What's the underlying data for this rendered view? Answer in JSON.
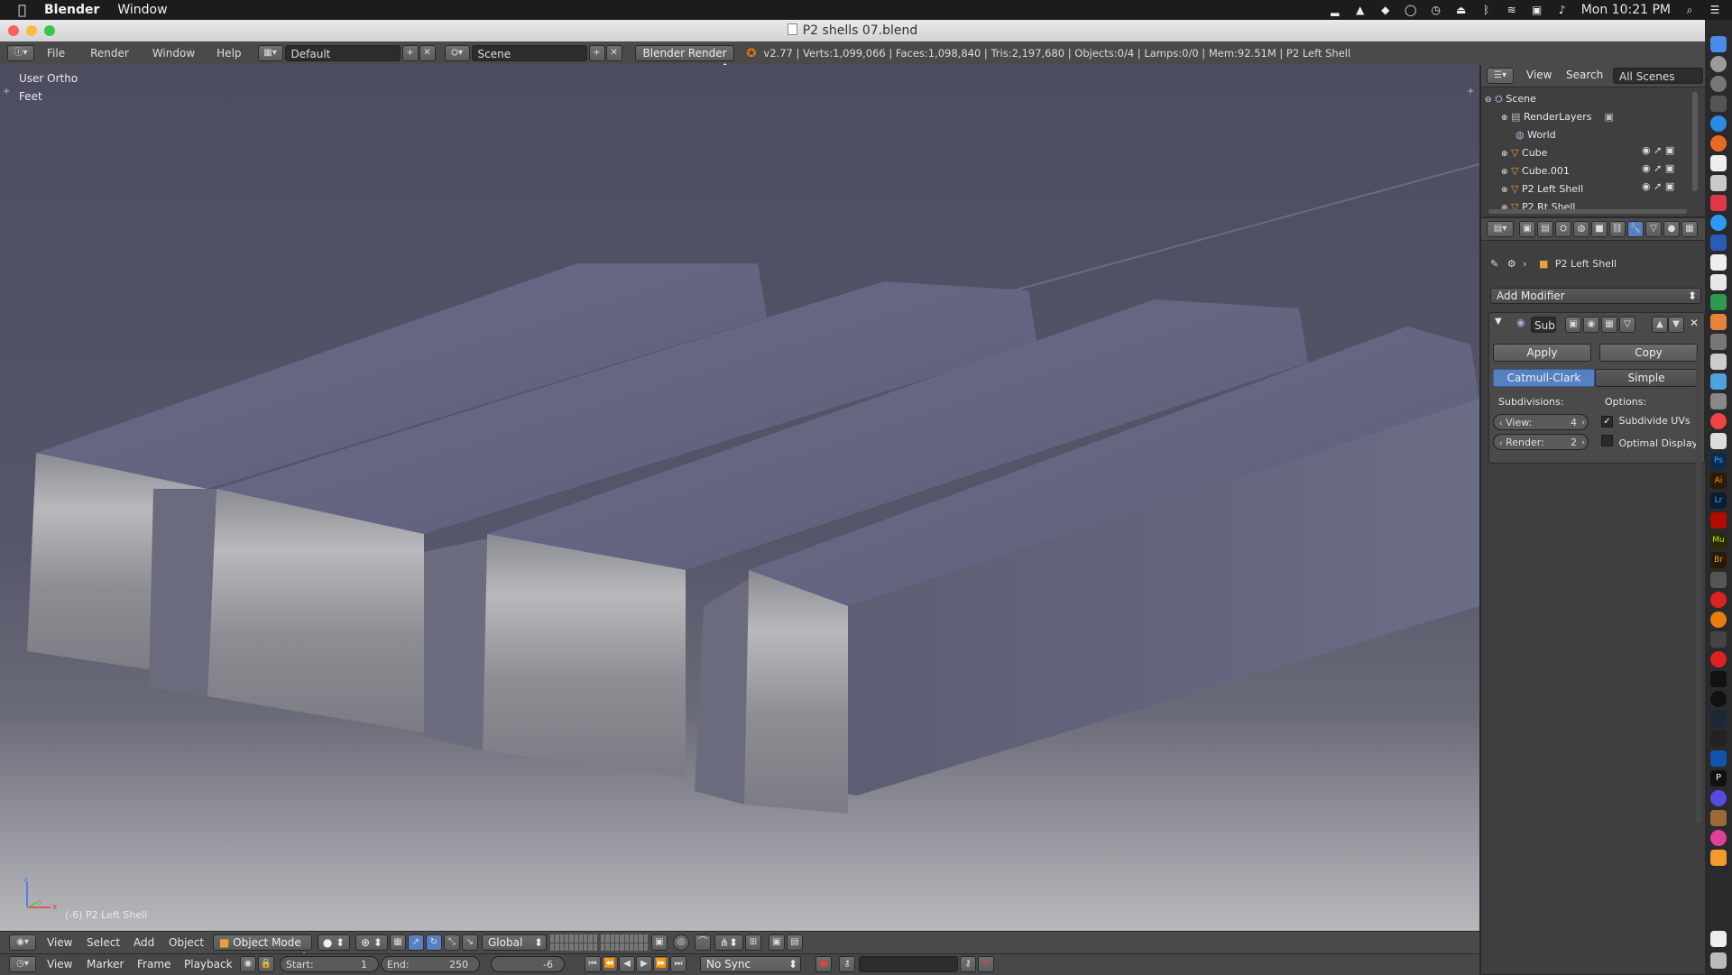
{
  "menubar": {
    "apple": "",
    "app": "Blender",
    "menu_window": "Window",
    "clock": "Mon 10:21 PM"
  },
  "window": {
    "title": "P2 shells 07.blend"
  },
  "header": {
    "menus": [
      "File",
      "Render",
      "Window",
      "Help"
    ],
    "layout": "Default",
    "scene": "Scene",
    "engine": "Blender Render",
    "stats": "v2.77 | Verts:1,099,066 | Faces:1,098,840 | Tris:2,197,680 | Objects:0/4 | Lamps:0/0 | Mem:92.51M | P2 Left Shell"
  },
  "viewport": {
    "view_name": "User Ortho",
    "units": "Feet",
    "object_label": "(-6) P2 Left Shell"
  },
  "outliner": {
    "view": "View",
    "search": "Search",
    "filter": "All Scenes",
    "items": [
      {
        "label": "Scene"
      },
      {
        "label": "RenderLayers"
      },
      {
        "label": "World"
      },
      {
        "label": "Cube"
      },
      {
        "label": "Cube.001"
      },
      {
        "label": "P2 Left Shell"
      },
      {
        "label": "P2 Rt Shell"
      }
    ]
  },
  "properties": {
    "object": "P2 Left Shell",
    "add_modifier": "Add Modifier",
    "modifier_name": "Sub",
    "apply": "Apply",
    "copy": "Copy",
    "catmull": "Catmull-Clark",
    "simple": "Simple",
    "subdivisions_label": "Subdivisions:",
    "options_label": "Options:",
    "view_label": "View:",
    "view_value": "4",
    "render_label": "Render:",
    "render_value": "2",
    "subdivide_uvs": "Subdivide UVs",
    "subdivide_uvs_checked": true,
    "optimal_display": "Optimal Display",
    "optimal_display_checked": false
  },
  "view_header": {
    "view": "View",
    "select": "Select",
    "add": "Add",
    "object": "Object",
    "mode": "Object Mode",
    "orientation": "Global"
  },
  "timeline": {
    "view": "View",
    "marker": "Marker",
    "frame": "Frame",
    "playback": "Playback",
    "start_label": "Start:",
    "start_value": "1",
    "end_label": "End:",
    "end_value": "250",
    "current": "-6",
    "sync": "No Sync"
  },
  "colors": {
    "accent": "#5680c2",
    "panel": "#3f3f3f",
    "header": "#4a4a4a"
  }
}
